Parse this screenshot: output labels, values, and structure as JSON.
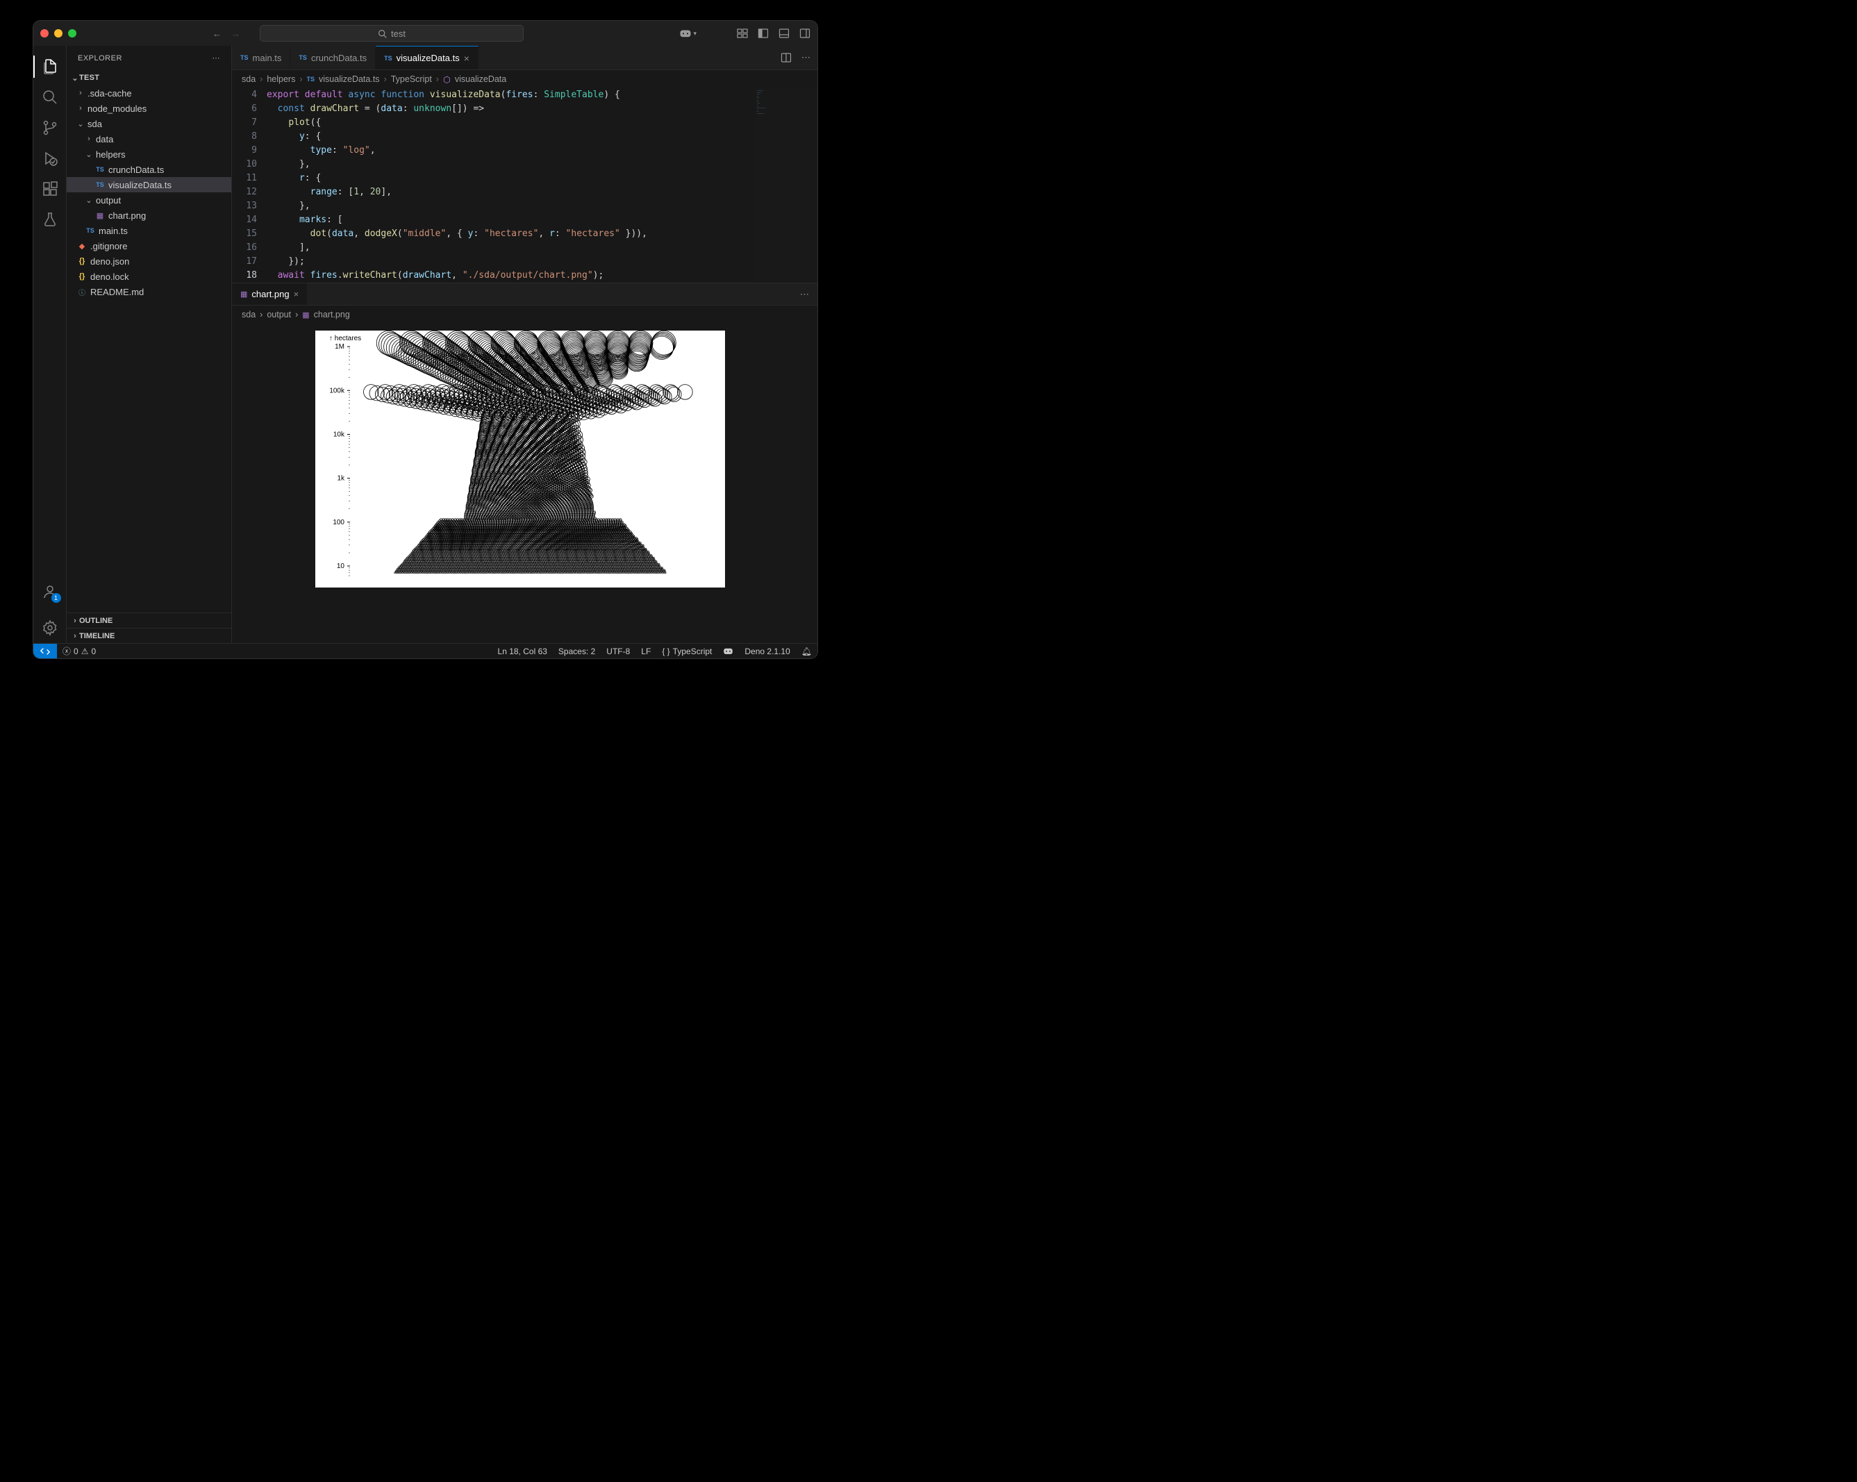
{
  "title_search": "test",
  "explorer": {
    "title": "EXPLORER"
  },
  "project_name": "TEST",
  "tree": {
    "sda_cache": ".sda-cache",
    "node_modules": "node_modules",
    "sda": "sda",
    "data": "data",
    "helpers": "helpers",
    "crunch": "crunchData.ts",
    "visualize": "visualizeData.ts",
    "output": "output",
    "chart_png": "chart.png",
    "main_ts": "main.ts",
    "gitignore": ".gitignore",
    "deno_json": "deno.json",
    "deno_lock": "deno.lock",
    "readme": "README.md"
  },
  "outline": "OUTLINE",
  "timeline": "TIMELINE",
  "tabs": {
    "main": "main.ts",
    "crunch": "crunchData.ts",
    "visualize": "visualizeData.ts"
  },
  "breadcrumb": {
    "p1": "sda",
    "p2": "helpers",
    "p3": "visualizeData.ts",
    "p4": "TypeScript",
    "p5": "visualizeData"
  },
  "code": {
    "l4": "export default async function visualizeData(fires: SimpleTable) {",
    "l6": "  const drawChart = (data: unknown[]) =>",
    "l7": "    plot({",
    "l8": "      y: {",
    "l9": "        type: \"log\",",
    "l10": "      },",
    "l11": "      r: {",
    "l12": "        range: [1, 20],",
    "l13": "      },",
    "l14": "      marks: [",
    "l15": "        dot(data, dodgeX(\"middle\", { y: \"hectares\", r: \"hectares\" })),",
    "l16": "      ],",
    "l17": "    });",
    "l18": "  await fires.writeChart(drawChart, \"./sda/output/chart.png\");"
  },
  "line_nums": [
    "4",
    "6",
    "7",
    "8",
    "9",
    "10",
    "11",
    "12",
    "13",
    "14",
    "15",
    "16",
    "17",
    "18"
  ],
  "panel_tab": "chart.png",
  "panel_breadcrumb": {
    "p1": "sda",
    "p2": "output",
    "p3": "chart.png"
  },
  "chart_data": {
    "type": "scatter",
    "title": "",
    "ylabel": "hectares",
    "yscale": "log",
    "yticks": [
      "10",
      "100",
      "1k",
      "10k",
      "100k",
      "1M"
    ],
    "ylim": [
      5,
      1500000
    ],
    "note": "beeswarm dot plot, dodgeX middle, radius encoded by hectares range [1,20]"
  },
  "status": {
    "errors": "0",
    "warnings": "0",
    "ln_col": "Ln 18, Col 63",
    "spaces": "Spaces: 2",
    "encoding": "UTF-8",
    "eol": "LF",
    "lang": "TypeScript",
    "runtime": "Deno 2.1.10"
  },
  "account_badge": "1"
}
